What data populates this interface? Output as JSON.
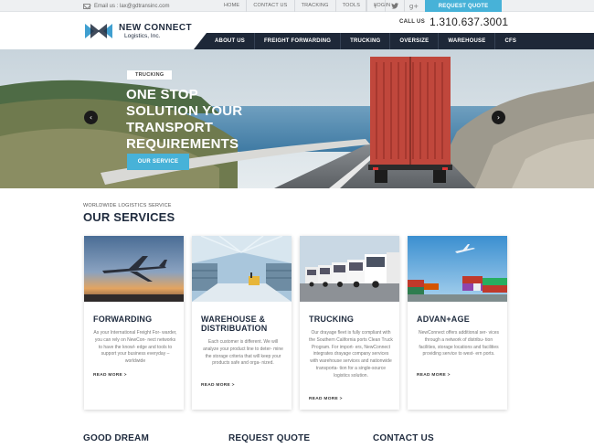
{
  "topbar": {
    "email": "Email us : lax@gdtransinc.com",
    "nav": [
      "HOME",
      "CONTACT US",
      "TRACKING",
      "TOOLS",
      "LOGIN"
    ],
    "socials": [
      "facebook-icon",
      "twitter-icon",
      "google-plus-icon"
    ],
    "quote_button": "REQUEST QUOTE"
  },
  "header": {
    "logo_line1": "NEW CONNECT",
    "logo_line2": "Logistics, Inc.",
    "call_label": "CALL US",
    "phone": "1.310.637.3001"
  },
  "mainnav": [
    "ABOUT US",
    "FREIGHT FORWARDING",
    "TRUCKING",
    "OVERSIZE",
    "WAREHOUSE",
    "CFS"
  ],
  "hero": {
    "badge": "TRUCKING",
    "title_lines": [
      "ONE STOP",
      "SOLUTION YOUR",
      "TRANSPORT",
      "REQUIREMENTS"
    ],
    "button": "OUR SERVICE",
    "prev": "‹",
    "next": "›"
  },
  "services": {
    "kicker": "WORLDWIDE LOGISTICS SERVICE",
    "title": "OUR SERVICES",
    "cards": [
      {
        "title_lines": [
          "FORWARDING"
        ],
        "desc": "As your International Freight For- warder, you can rely on NewCon- nect networks to have the knowl- edge and tools to support your business everyday – worldwide",
        "more": "READ MORE >"
      },
      {
        "title_lines": [
          "WAREHOUSE &",
          "DISTRIBUATION"
        ],
        "desc": "Each customer is different.  We will analyze your product line to deter- mine the storage criteria that will keep your products safe and orga- nized.",
        "more": "READ MORE >"
      },
      {
        "title_lines": [
          "TRUCKING"
        ],
        "desc": "Our drayage fleet is fully compliant with the Southern California ports Clean Truck Program.  For import- ers, NewConnect integrates drayage company services with warehouse services and nationwide transporta- tion for a single-source logistics solution.",
        "more": "READ MORE >"
      },
      {
        "title_lines": [
          "ADVAN+AGE"
        ],
        "desc": "NewConnect offers additional ser- vices through a network of distribu- tion facilities, storage locations and facilities providing service to west- ern ports.",
        "more": "READ MORE >"
      }
    ]
  },
  "footer": {
    "headings": [
      "GOOD DREAM",
      "REQUEST QUOTE",
      "CONTACT US"
    ]
  }
}
